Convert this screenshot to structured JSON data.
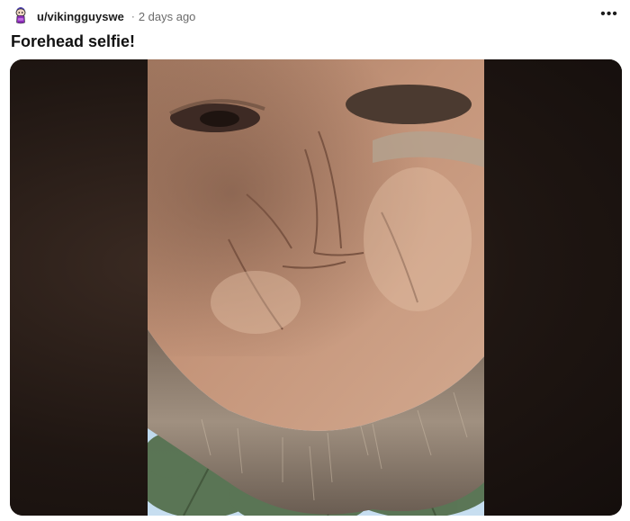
{
  "post": {
    "username": "u/vikingguyswe",
    "separator": "·",
    "time": "2 days ago",
    "title": "Forehead selfie!",
    "more_label": "•••"
  },
  "media": {
    "description_icon": "photo"
  },
  "colors": {
    "background": "#ffffff",
    "text_primary": "#111111",
    "text_secondary": "#6b6b6b",
    "media_letterbox": "#1e1512",
    "avatar_accent": "#8b2fb8"
  }
}
